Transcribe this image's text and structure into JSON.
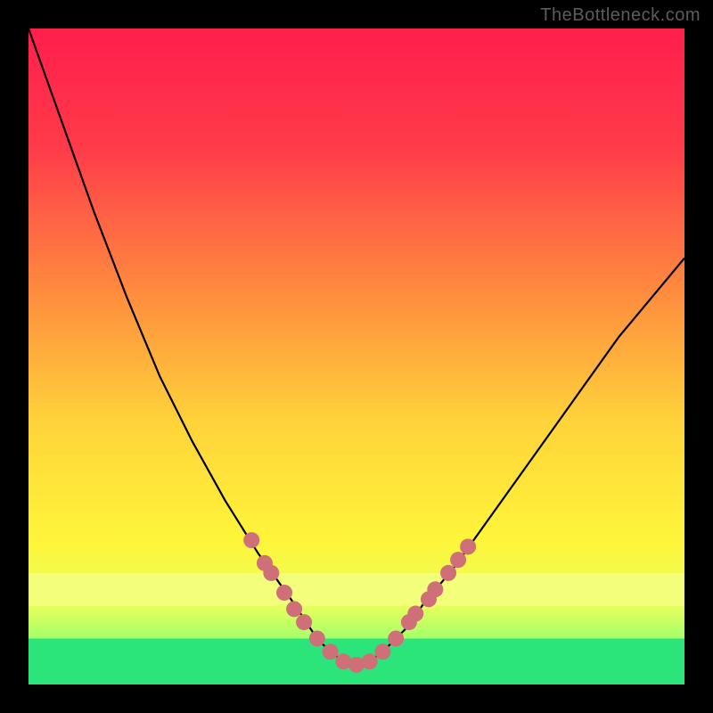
{
  "watermark": "TheBottleneck.com",
  "chart_data": {
    "type": "line",
    "title": "",
    "xlabel": "",
    "ylabel": "",
    "xlim": [
      0,
      100
    ],
    "ylim": [
      0,
      100
    ],
    "grid": false,
    "legend": false,
    "series": [
      {
        "name": "curve",
        "x": [
          0,
          5,
          10,
          15,
          20,
          25,
          30,
          35,
          40,
          42,
          44,
          46,
          48,
          50,
          52,
          54,
          56,
          58,
          60,
          65,
          70,
          75,
          80,
          85,
          90,
          95,
          100
        ],
        "y": [
          100,
          86,
          72,
          59,
          47,
          37,
          28,
          20,
          13,
          10,
          7,
          5,
          3.5,
          3,
          3.5,
          5,
          7,
          9,
          12,
          18,
          25,
          32,
          39,
          46,
          53,
          59,
          65
        ]
      }
    ],
    "markers": {
      "name": "points",
      "color": "#cf6f77",
      "radius": 9,
      "items": [
        {
          "x": 34,
          "y": 22
        },
        {
          "x": 36,
          "y": 18.5
        },
        {
          "x": 37,
          "y": 17
        },
        {
          "x": 39,
          "y": 14
        },
        {
          "x": 40.5,
          "y": 11.5
        },
        {
          "x": 42,
          "y": 9.5
        },
        {
          "x": 44,
          "y": 7
        },
        {
          "x": 46,
          "y": 5
        },
        {
          "x": 48,
          "y": 3.5
        },
        {
          "x": 50,
          "y": 3
        },
        {
          "x": 52,
          "y": 3.5
        },
        {
          "x": 54,
          "y": 5
        },
        {
          "x": 56,
          "y": 7
        },
        {
          "x": 58,
          "y": 9.5
        },
        {
          "x": 59,
          "y": 10.8
        },
        {
          "x": 61,
          "y": 13
        },
        {
          "x": 62,
          "y": 14.5
        },
        {
          "x": 64,
          "y": 17
        },
        {
          "x": 65.5,
          "y": 19
        },
        {
          "x": 67,
          "y": 21
        }
      ]
    },
    "bands": [
      {
        "name": "lime-band",
        "y0": 12,
        "y1": 17,
        "color": "#f3ff7a"
      },
      {
        "name": "green-band",
        "y0": 0,
        "y1": 7,
        "color": "#2ce57a"
      }
    ]
  }
}
